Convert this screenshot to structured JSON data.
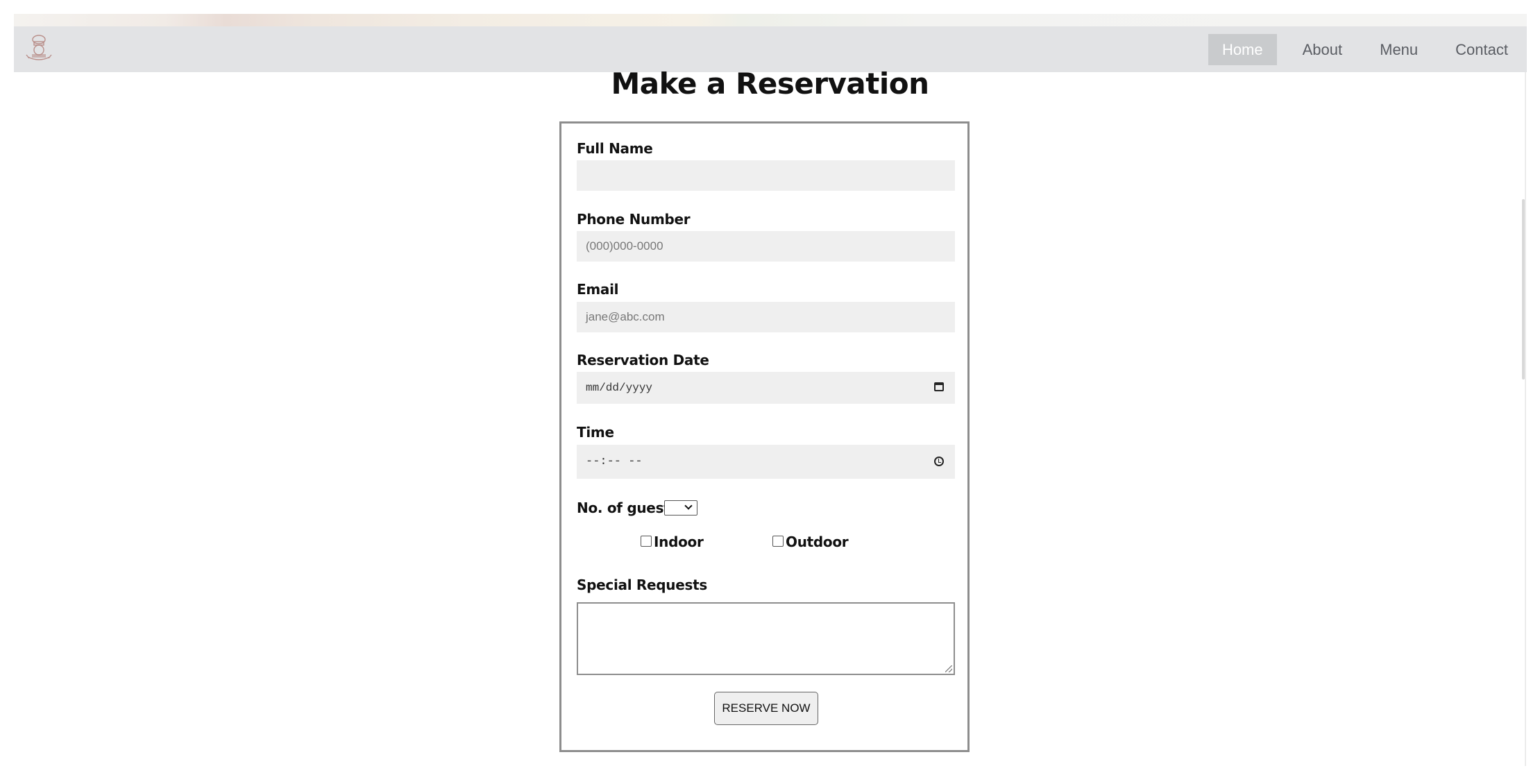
{
  "nav": {
    "logo_alt": "chef logo",
    "links": [
      "Home",
      "About",
      "Menu",
      "Contact"
    ],
    "active": "Home"
  },
  "page_title": "Make a Reservation",
  "form": {
    "full_name": {
      "label": "Full Name",
      "value": "",
      "placeholder": ""
    },
    "phone": {
      "label": "Phone Number",
      "placeholder": "(000)000-0000"
    },
    "email": {
      "label": "Email",
      "placeholder": "jane@abc.com"
    },
    "date": {
      "label": "Reservation Date",
      "placeholder": "mm/dd/yyyy"
    },
    "time": {
      "label": "Time",
      "placeholder": "--:-- --"
    },
    "guests": {
      "label": "No. of guests",
      "value": ""
    },
    "seating": {
      "indoor": "Indoor",
      "outdoor": "Outdoor"
    },
    "special_requests": {
      "label": "Special Requests",
      "value": ""
    },
    "submit_label": "RESERVE NOW"
  },
  "icons": [
    "chef-logo-icon",
    "calendar-icon",
    "clock-icon",
    "chevron-down-icon"
  ]
}
